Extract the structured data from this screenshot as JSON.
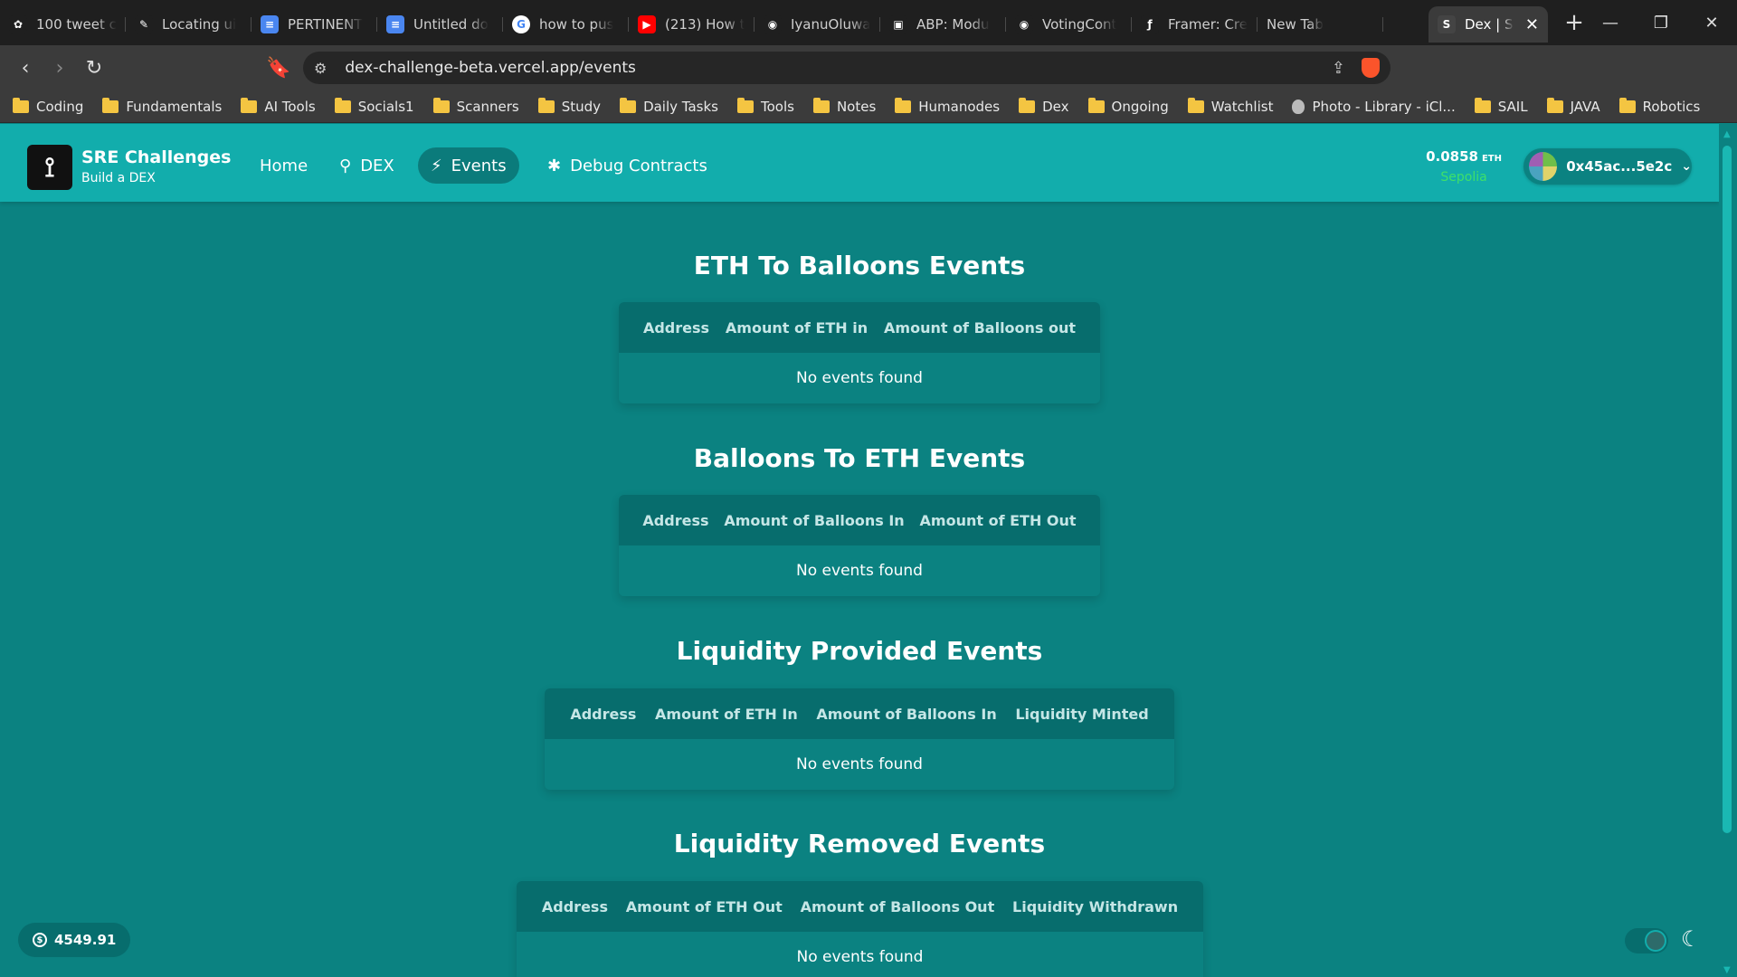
{
  "browser": {
    "tabs": [
      {
        "label": "100 tweet c",
        "icon": "openai-icon",
        "color": "#1f1f1f"
      },
      {
        "label": "Locating ui",
        "icon": "perplexity-icon",
        "color": "#1f1f1f"
      },
      {
        "label": "PERTINENT",
        "icon": "docs-icon",
        "color": "#4a86f0"
      },
      {
        "label": "Untitled do",
        "icon": "docs-icon",
        "color": "#4a86f0"
      },
      {
        "label": "how to pus",
        "icon": "google-icon",
        "color": "#ffffff"
      },
      {
        "label": "(213) How t",
        "icon": "youtube-icon",
        "color": "#ff0000"
      },
      {
        "label": "IyanuOluwa",
        "icon": "github-icon",
        "color": "#1f1f1f"
      },
      {
        "label": "ABP: Modu",
        "icon": "abp-icon",
        "color": "#1f1f1f"
      },
      {
        "label": "VotingCont",
        "icon": "github-icon",
        "color": "#1f1f1f"
      },
      {
        "label": "Framer: Cre",
        "icon": "framer-icon",
        "color": "#1f1f1f"
      },
      {
        "label": "New Tab",
        "icon": "",
        "color": ""
      }
    ],
    "active_tab": {
      "label": "Dex | S",
      "icon": "scaffold-icon"
    },
    "url": "dex-challenge-beta.vercel.app/events",
    "bookmarks": [
      "Coding",
      "Fundamentals",
      "AI Tools",
      "Socials1",
      "Scanners",
      "Study",
      "Daily Tasks",
      "Tools",
      "Notes",
      "Humanodes",
      "Dex",
      "Ongoing",
      "Watchlist",
      "Photo - Library - iCl...",
      "SAIL",
      "JAVA",
      "Robotics"
    ]
  },
  "header": {
    "brand_title": "SRE Challenges",
    "brand_sub": "Build a DEX",
    "nav": [
      {
        "label": "Home",
        "icon": ""
      },
      {
        "label": "DEX",
        "icon": "wrench-icon"
      },
      {
        "label": "Events",
        "icon": "bolt-icon",
        "active": true
      },
      {
        "label": "Debug Contracts",
        "icon": "bug-icon"
      }
    ],
    "balance": {
      "amount": "0.0858",
      "unit": "ETH",
      "network": "Sepolia"
    },
    "account": "0x45ac...5e2c"
  },
  "sections": [
    {
      "title": "ETH To Balloons Events",
      "columns": [
        "Address",
        "Amount of ETH in",
        "Amount of Balloons out"
      ],
      "empty": "No events found"
    },
    {
      "title": "Balloons To ETH Events",
      "columns": [
        "Address",
        "Amount of Balloons In",
        "Amount of ETH Out"
      ],
      "empty": "No events found"
    },
    {
      "title": "Liquidity Provided Events",
      "columns": [
        "Address",
        "Amount of ETH In",
        "Amount of Balloons In",
        "Liquidity Minted"
      ],
      "empty": "No events found"
    },
    {
      "title": "Liquidity Removed Events",
      "columns": [
        "Address",
        "Amount of ETH Out",
        "Amount of Balloons Out",
        "Liquidity Withdrawn"
      ],
      "empty": "No events found"
    }
  ],
  "price": "4549.91",
  "colors": {
    "header": "#12adac",
    "page": "#0b8281",
    "table_head": "#076d6d",
    "network": "#3ee06a"
  }
}
